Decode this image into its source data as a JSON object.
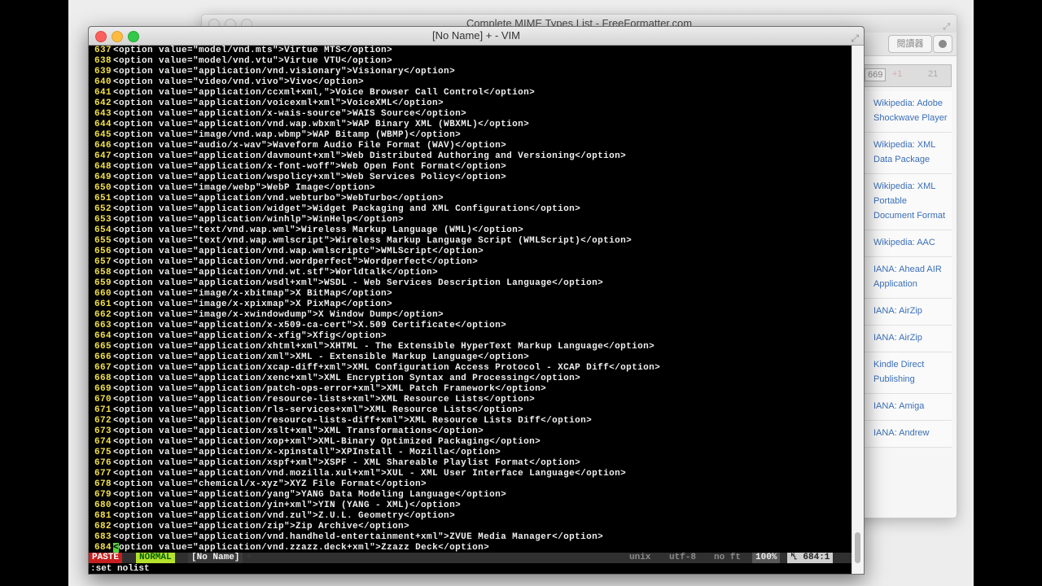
{
  "browser": {
    "title": "Complete MIME Types List - FreeFormatter.com",
    "reader_label": "閱讀器",
    "social": {
      "count": "669",
      "plus": "+1",
      "count2": "21"
    },
    "sidebar_links": [
      "Wikipedia: Adobe Shockwave Player",
      "Wikipedia: XML Data Package",
      "Wikipedia: XML Portable Document Format",
      "Wikipedia: AAC",
      "IANA: Ahead AIR Application",
      "IANA: AirZip",
      "IANA: AirZip",
      "Kindle Direct Publishing",
      "IANA: Amiga",
      "IANA: Andrew"
    ]
  },
  "vim": {
    "title": "[No Name] + - VIM",
    "lines": [
      {
        "n": "637",
        "t": "<option value=\"model/vnd.mts\">Virtue MTS</option>"
      },
      {
        "n": "638",
        "t": "<option value=\"model/vnd.vtu\">Virtue VTU</option>"
      },
      {
        "n": "639",
        "t": "<option value=\"application/vnd.visionary\">Visionary</option>"
      },
      {
        "n": "640",
        "t": "<option value=\"video/vnd.vivo\">Vivo</option>"
      },
      {
        "n": "641",
        "t": "<option value=\"application/ccxml+xml,\">Voice Browser Call Control</option>"
      },
      {
        "n": "642",
        "t": "<option value=\"application/voicexml+xml\">VoiceXML</option>"
      },
      {
        "n": "643",
        "t": "<option value=\"application/x-wais-source\">WAIS Source</option>"
      },
      {
        "n": "644",
        "t": "<option value=\"application/vnd.wap.wbxml\">WAP Binary XML (WBXML)</option>"
      },
      {
        "n": "645",
        "t": "<option value=\"image/vnd.wap.wbmp\">WAP Bitamp (WBMP)</option>"
      },
      {
        "n": "646",
        "t": "<option value=\"audio/x-wav\">Waveform Audio File Format (WAV)</option>"
      },
      {
        "n": "647",
        "t": "<option value=\"application/davmount+xml\">Web Distributed Authoring and Versioning</option>"
      },
      {
        "n": "648",
        "t": "<option value=\"application/x-font-woff\">Web Open Font Format</option>"
      },
      {
        "n": "649",
        "t": "<option value=\"application/wspolicy+xml\">Web Services Policy</option>"
      },
      {
        "n": "650",
        "t": "<option value=\"image/webp\">WebP Image</option>"
      },
      {
        "n": "651",
        "t": "<option value=\"application/vnd.webturbo\">WebTurbo</option>"
      },
      {
        "n": "652",
        "t": "<option value=\"application/widget\">Widget Packaging and XML Configuration</option>"
      },
      {
        "n": "653",
        "t": "<option value=\"application/winhlp\">WinHelp</option>"
      },
      {
        "n": "654",
        "t": "<option value=\"text/vnd.wap.wml\">Wireless Markup Language (WML)</option>"
      },
      {
        "n": "655",
        "t": "<option value=\"text/vnd.wap.wmlscript\">Wireless Markup Language Script (WMLScript)</option>"
      },
      {
        "n": "656",
        "t": "<option value=\"application/vnd.wap.wmlscriptc\">WMLScript</option>"
      },
      {
        "n": "657",
        "t": "<option value=\"application/vnd.wordperfect\">Wordperfect</option>"
      },
      {
        "n": "658",
        "t": "<option value=\"application/vnd.wt.stf\">Worldtalk</option>"
      },
      {
        "n": "659",
        "t": "<option value=\"application/wsdl+xml\">WSDL - Web Services Description Language</option>"
      },
      {
        "n": "660",
        "t": "<option value=\"image/x-xbitmap\">X BitMap</option>"
      },
      {
        "n": "661",
        "t": "<option value=\"image/x-xpixmap\">X PixMap</option>"
      },
      {
        "n": "662",
        "t": "<option value=\"image/x-xwindowdump\">X Window Dump</option>"
      },
      {
        "n": "663",
        "t": "<option value=\"application/x-x509-ca-cert\">X.509 Certificate</option>"
      },
      {
        "n": "664",
        "t": "<option value=\"application/x-xfig\">Xfig</option>"
      },
      {
        "n": "665",
        "t": "<option value=\"application/xhtml+xml\">XHTML - The Extensible HyperText Markup Language</option>"
      },
      {
        "n": "666",
        "t": "<option value=\"application/xml\">XML - Extensible Markup Language</option>"
      },
      {
        "n": "667",
        "t": "<option value=\"application/xcap-diff+xml\">XML Configuration Access Protocol - XCAP Diff</option>"
      },
      {
        "n": "668",
        "t": "<option value=\"application/xenc+xml\">XML Encryption Syntax and Processing</option>"
      },
      {
        "n": "669",
        "t": "<option value=\"application/patch-ops-error+xml\">XML Patch Framework</option>"
      },
      {
        "n": "670",
        "t": "<option value=\"application/resource-lists+xml\">XML Resource Lists</option>"
      },
      {
        "n": "671",
        "t": "<option value=\"application/rls-services+xml\">XML Resource Lists</option>"
      },
      {
        "n": "672",
        "t": "<option value=\"application/resource-lists-diff+xml\">XML Resource Lists Diff</option>"
      },
      {
        "n": "673",
        "t": "<option value=\"application/xslt+xml\">XML Transformations</option>"
      },
      {
        "n": "674",
        "t": "<option value=\"application/xop+xml\">XML-Binary Optimized Packaging</option>"
      },
      {
        "n": "675",
        "t": "<option value=\"application/x-xpinstall\">XPInstall - Mozilla</option>"
      },
      {
        "n": "676",
        "t": "<option value=\"application/xspf+xml\">XSPF - XML Shareable Playlist Format</option>"
      },
      {
        "n": "677",
        "t": "<option value=\"application/vnd.mozilla.xul+xml\">XUL - XML User Interface Language</option>"
      },
      {
        "n": "678",
        "t": "<option value=\"chemical/x-xyz\">XYZ File Format</option>"
      },
      {
        "n": "679",
        "t": "<option value=\"application/yang\">YANG Data Modeling Language</option>"
      },
      {
        "n": "680",
        "t": "<option value=\"application/yin+xml\">YIN (YANG - XML)</option>"
      },
      {
        "n": "681",
        "t": "<option value=\"application/vnd.zul\">Z.U.L. Geometry</option>"
      },
      {
        "n": "682",
        "t": "<option value=\"application/zip\">Zip Archive</option>"
      },
      {
        "n": "683",
        "t": "<option value=\"application/vnd.handheld-entertainment+xml\">ZVUE Media Manager</option>"
      },
      {
        "n": "684",
        "t": "<option value=\"application/vnd.zzazz.deck+xml\">Zzazz Deck</option>"
      }
    ],
    "status": {
      "paste": "PASTE",
      "mode": "NORMAL",
      "filename": "[No Name]",
      "modified_marker": "+",
      "fileformat": "unix",
      "encoding": "utf-8",
      "filetype": "no ft",
      "percent": "100%",
      "position": "684:1"
    },
    "command": ":set nolist"
  }
}
